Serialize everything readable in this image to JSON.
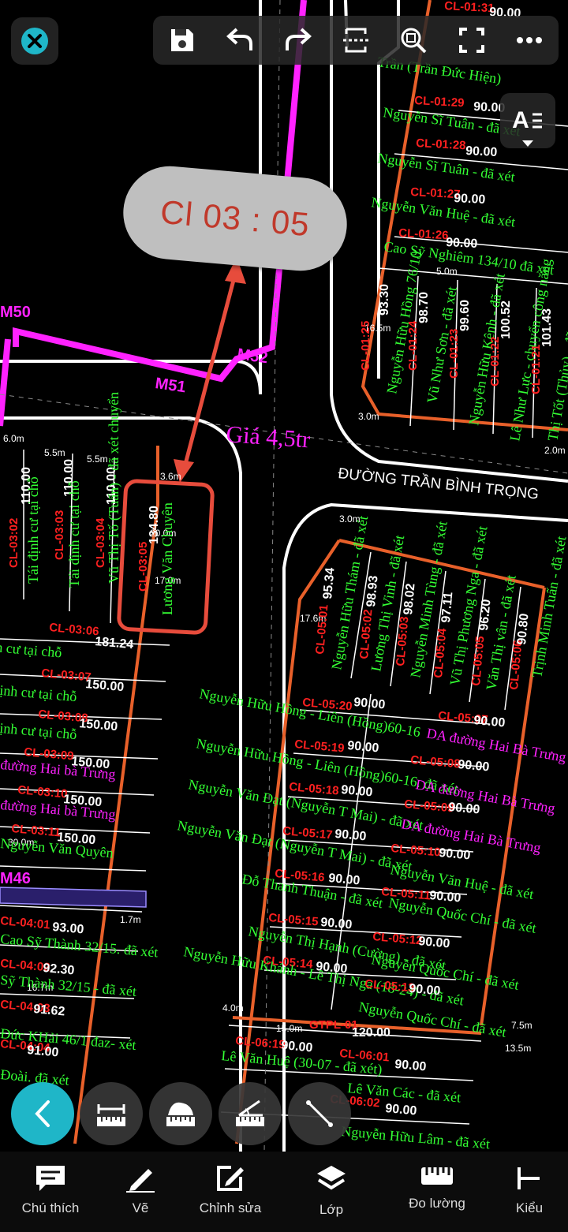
{
  "toolbar": {
    "close": "close-icon",
    "save": "save-icon",
    "undo": "undo-icon",
    "redo": "redo-icon",
    "crop": "crop-icon",
    "zoom": "zoom-icon",
    "fullscreen": "fullscreen-icon",
    "more": "more-icon"
  },
  "text_toggle": {
    "label": "A"
  },
  "callout": {
    "text": "Cl 03 : 05"
  },
  "map": {
    "price_label": "Giá 4,5tr",
    "street_name": "ĐƯỜNG TRẦN BÌNH TRỌNG",
    "markers": [
      "M50",
      "M51",
      "M52",
      "M46"
    ],
    "dims": [
      "6.0m",
      "5.5m",
      "5.5m",
      "3.6m",
      "3.0m",
      "5.0m",
      "17.0m",
      "20.0m",
      "17.6m",
      "4.0m",
      "15.0m",
      "13.5m",
      "7.5m",
      "30.0m",
      "16.7m",
      "1.7m",
      "16.5m",
      "2.0m",
      "3.0m"
    ],
    "lots_left": [
      {
        "id": "CL-03:02",
        "area": "110.00",
        "owner": "Tái định cư tại chỗ"
      },
      {
        "id": "CL-03:03",
        "area": "110.00",
        "owner": "Tái định cư tại chỗ"
      },
      {
        "id": "CL-03:04",
        "area": "110.00",
        "owner": "Vũ Thị Tố (Tuấn) - đã xét chuyển"
      },
      {
        "id": "CL-03:05",
        "area": "134.80",
        "owner": "Lương Văn Chuyên"
      },
      {
        "id": "CL-03:06",
        "area": "181.24",
        "owner": "inh cư tại chỗ"
      },
      {
        "id": "CL-03:07",
        "area": "150.00",
        "owner": "định cư tại chỗ"
      },
      {
        "id": "CL-03:08",
        "area": "150.00",
        "owner": "định cư tại chỗ"
      },
      {
        "id": "CL-03:09",
        "area": "150.00",
        "owner": "đường Hai bà Trưng"
      },
      {
        "id": "CL-03:10",
        "area": "150.00",
        "owner": "đường Hai bà Trưng"
      },
      {
        "id": "CL-03:11",
        "area": "150.00",
        "owner": "Nguyễn Văn Quyên"
      },
      {
        "id": "CL-04:01",
        "area": "93.00",
        "owner": "Cao Sỹ Thành 32/15. đã xét"
      },
      {
        "id": "CL-04:02",
        "area": "92.30",
        "owner": "Sỹ Thành 32/15 - đã xét"
      },
      {
        "id": "CL-04:03",
        "area": "91.62",
        "owner": "Đức KHải 46/1 đaz- xét"
      },
      {
        "id": "CL-04:04",
        "area": "91.00",
        "owner": "Đoài. đã xét"
      }
    ],
    "lots_top": [
      {
        "id": "CL-01:31",
        "area": "90.00",
        "owner": "Trần (Trần Đức Hiện)"
      },
      {
        "id": "CL-01:29",
        "area": "90.00",
        "owner": "Nguyễn Sĩ Tuân - đã xét"
      },
      {
        "id": "CL-01:28",
        "area": "90.00",
        "owner": "Nguyễn Sĩ Tuân - đã xét"
      },
      {
        "id": "CL-01:27",
        "area": "90.00",
        "owner": "Nguyễn Văn Huệ - đã xét"
      },
      {
        "id": "CL-01:26",
        "area": "90.00",
        "owner": "Cao Sỹ Nghiêm 134/10 đã xét"
      },
      {
        "id": "CL-01:25",
        "area": "93.30",
        "owner": "Nguyễn Hữu Hồng 76/10"
      },
      {
        "id": "CL-01:24",
        "area": "98.70",
        "owner": "Vũ Như Sơn - đã xét"
      },
      {
        "id": "CL-01:23",
        "area": "99.60",
        "owner": "Nguyễn Hữu Kênh - đã xét"
      },
      {
        "id": "CL-01:22",
        "area": "100.52",
        "owner": "Lê Như Lực - chuyển công năng"
      },
      {
        "id": "CL-01:21",
        "area": "101.43",
        "owner": "Thị Tốt (Thủy) - đã xét"
      }
    ],
    "lots_right": [
      {
        "id": "CL-05:01",
        "area": "95.34",
        "owner": "Nguyễn Hữu Thám - đã xét"
      },
      {
        "id": "CL-05:02",
        "area": "98.93",
        "owner": "Lương Thị Vinh - đã xét"
      },
      {
        "id": "CL-05:03",
        "area": "98.02",
        "owner": "Nguyễn Minh Tùng - đã xét"
      },
      {
        "id": "CL-05:04",
        "area": "97.11",
        "owner": "Vũ Thị Phương Nga - đã xét"
      },
      {
        "id": "CL-05:05",
        "area": "96.20",
        "owner": "Văn Thị vân - đã xét"
      },
      {
        "id": "CL-05:06",
        "area": "90.80",
        "owner": "Trịnh Minh Tuấn - đã xét"
      },
      {
        "id": "CL-05:20",
        "area": "90.00",
        "owner": "Nguyễn Hữu Hồng - Liên (Hồng)60-16"
      },
      {
        "id": "CL-05:19",
        "area": "90.00",
        "owner": "Nguyễn Hữu Hồng - Liên (Hồng)60-16. đã xét"
      },
      {
        "id": "CL-05:18",
        "area": "90.00",
        "owner": "Nguyễn Văn Đạt (Nguyễn T Mai) - đã xét"
      },
      {
        "id": "CL-05:17",
        "area": "90.00",
        "owner": "Nguyễn Văn Đạt (Nguyễn T Mai) - đã xét"
      },
      {
        "id": "CL-05:16",
        "area": "90.00",
        "owner": "Đỗ Thanh Thuận - đã xét"
      },
      {
        "id": "CL-05:15",
        "area": "90.00",
        "owner": "Nguyễn Thị Hạnh (Cường) - đã xét"
      },
      {
        "id": "CL-05:14",
        "area": "90.00",
        "owner": "Nguyễn Hữu Khánh - Lê Thị Nga (18-24) - đã xét"
      },
      {
        "id": "CL-05:07",
        "area": "90.00",
        "owner": "DA đường Hai Bà Trưng"
      },
      {
        "id": "CL-05:08",
        "area": "90.00",
        "owner": "DA đường Hai Bà Trưng"
      },
      {
        "id": "CL-05:09",
        "area": "90.00",
        "owner": "DA đường Hai Bà Trưng"
      },
      {
        "id": "CL-05:10",
        "area": "90.00",
        "owner": "Nguyễn Văn Huệ - đã xét"
      },
      {
        "id": "CL-05:11",
        "area": "90.00",
        "owner": "Nguyễn Quốc Chí - đã xét"
      },
      {
        "id": "CL-05:12",
        "area": "90.00",
        "owner": "Nguyễn Quốc Chí - đã xét"
      },
      {
        "id": "CL-05:13",
        "area": "90.00",
        "owner": "Nguyễn Quốc Chí - đã xét"
      },
      {
        "id": "GTPL-01",
        "area": "120.00",
        "owner": ""
      },
      {
        "id": "CL-06:19",
        "area": "90.00",
        "owner": "Lê Văn Huệ (30-07 - đã xét)"
      },
      {
        "id": "CL-06:01",
        "area": "90.00",
        "owner": "Lê Văn Các - đã xét"
      },
      {
        "id": "CL-06:02",
        "area": "90.00",
        "owner": "Nguyễn Hữu Lâm - đã xét"
      }
    ]
  },
  "tools": [
    "back-icon",
    "measure-distance-icon",
    "measure-area-icon",
    "measure-angle-icon",
    "line-icon"
  ],
  "bottom_nav": [
    {
      "label": "Chú thích",
      "icon": "comment-icon"
    },
    {
      "label": "Vẽ",
      "icon": "pencil-icon"
    },
    {
      "label": "Chỉnh sửa",
      "icon": "edit-icon"
    },
    {
      "label": "Lớp",
      "icon": "layers-icon"
    },
    {
      "label": "Đo lường",
      "icon": "ruler-icon"
    },
    {
      "label": "Kiểu",
      "icon": "style-icon"
    }
  ],
  "colors": {
    "boundary": "#e8602a",
    "lot_id": "#ff2020",
    "owner": "#33ff33",
    "road": "#ffffff",
    "magenta": "#ff22ff",
    "callout_text": "#c0392b",
    "accent": "#1fb6c8"
  }
}
